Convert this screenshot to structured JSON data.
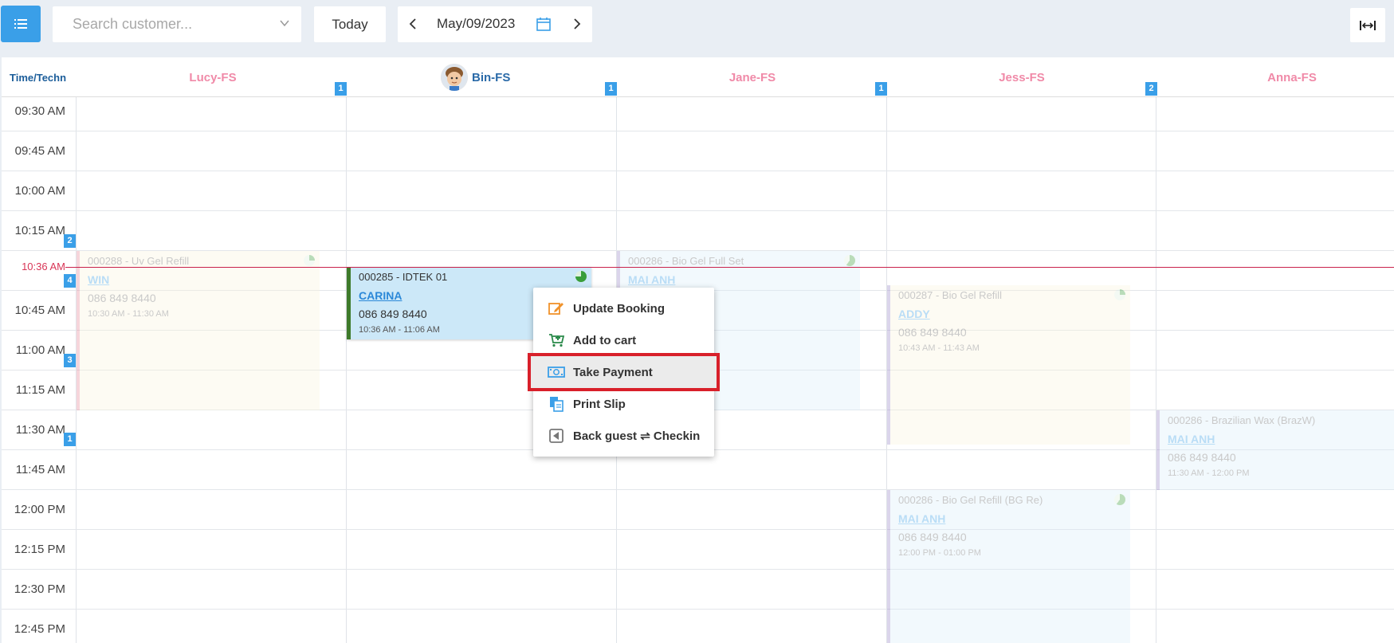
{
  "toolbar": {
    "search_placeholder": "Search customer...",
    "today_label": "Today",
    "date": "May/09/2023"
  },
  "grid": {
    "corner_label": "Time/Techn",
    "technicians": [
      {
        "name": "Lucy-FS",
        "badge": "1"
      },
      {
        "name": "Bin-FS",
        "badge": "1"
      },
      {
        "name": "Jane-FS",
        "badge": "1"
      },
      {
        "name": "Jess-FS",
        "badge": "2"
      },
      {
        "name": "Anna-FS",
        "badge": ""
      }
    ],
    "times": [
      "09:30 AM",
      "09:45 AM",
      "10:00 AM",
      "10:15 AM",
      "10:36 AM",
      "10:45 AM",
      "11:00 AM",
      "11:15 AM",
      "11:30 AM",
      "11:45 AM",
      "12:00 PM",
      "12:15 PM",
      "12:30 PM",
      "12:45 PM"
    ],
    "time_badges": [
      "2",
      "4",
      "3",
      "1"
    ]
  },
  "appointments": [
    {
      "title": "000288 - Uv Gel Refill",
      "customer": "WIN",
      "phone": "086 849 8440",
      "time": "10:30 AM - 11:30 AM"
    },
    {
      "title": "000285 - IDTEK 01",
      "customer": "CARINA",
      "phone": "086 849 8440",
      "time": "10:36 AM - 11:06 AM"
    },
    {
      "title": "000286 - Bio Gel Full Set",
      "customer": "MAI ANH",
      "phone": "",
      "time": ""
    },
    {
      "title": "000287 - Bio Gel Refill",
      "customer": "ADDY",
      "phone": "086 849 8440",
      "time": "10:43 AM - 11:43 AM"
    },
    {
      "title": "000286 - Brazilian Wax (BrazW)",
      "customer": "MAI ANH",
      "phone": "086 849 8440",
      "time": "11:30 AM - 12:00 PM"
    },
    {
      "title": "000286 - Bio Gel Refill (BG Re)",
      "customer": "MAI ANH",
      "phone": "086 849 8440",
      "time": "12:00 PM - 01:00 PM"
    }
  ],
  "context_menu": {
    "items": [
      "Update Booking",
      "Add to cart",
      "Take Payment",
      "Print Slip",
      "Back guest ⇌ Checkin"
    ]
  },
  "colors": {
    "accent": "#3a9fe8",
    "tech_pink": "#f08aa8",
    "now_line": "#c9224c",
    "highlight": "#d8202a"
  }
}
